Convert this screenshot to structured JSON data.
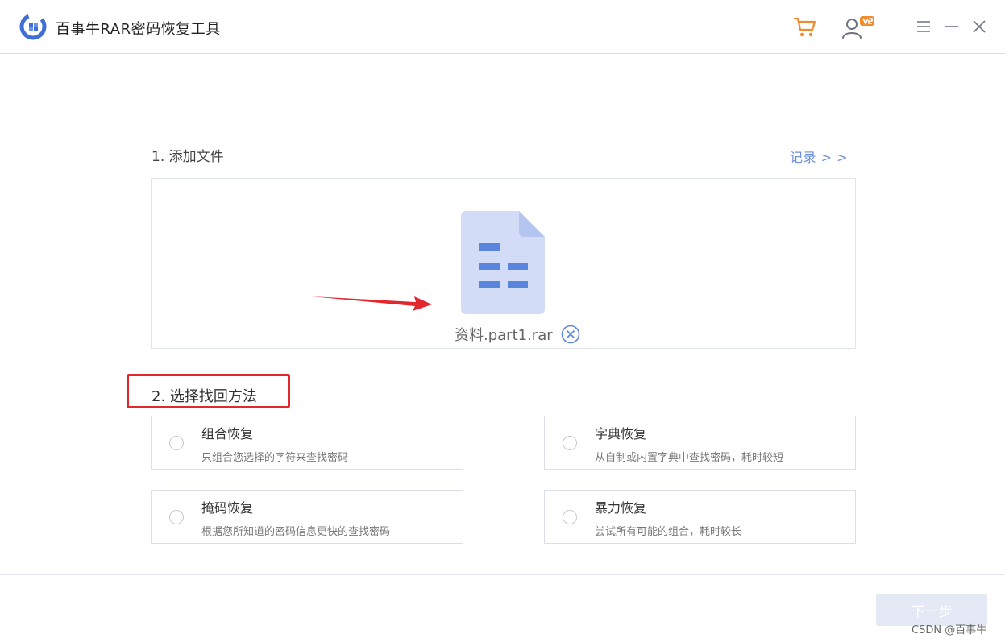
{
  "app": {
    "title": "百事牛RAR密码恢复工具"
  },
  "icons": {
    "logo": "app-logo-icon",
    "cart": "cart-icon",
    "user": "user-vip-icon",
    "menu": "menu-icon",
    "minimize": "minimize-icon",
    "close": "close-icon",
    "file": "file-document-icon",
    "remove": "remove-circle-icon"
  },
  "colors": {
    "accent": "#f08c2e",
    "link": "#6b8fd6",
    "file_icon": "#d3dcf7",
    "file_lines": "#5b84dd",
    "annotation": "#e2272d",
    "button_disabled": "#e5e9f5"
  },
  "step1": {
    "title": "1. 添加文件",
    "records_link": "记录 > >",
    "file_name": "资料.part1.rar"
  },
  "step2": {
    "title": "2. 选择找回方法",
    "methods": [
      {
        "title": "组合恢复",
        "desc": "只组合您选择的字符来查找密码"
      },
      {
        "title": "字典恢复",
        "desc": "从自制或内置字典中查找密码，耗时较短"
      },
      {
        "title": "掩码恢复",
        "desc": "根据您所知道的密码信息更快的查找密码"
      },
      {
        "title": "暴力恢复",
        "desc": "尝试所有可能的组合，耗时较长"
      }
    ]
  },
  "footer": {
    "next_label": "下一步",
    "watermark": "CSDN @百事牛"
  }
}
